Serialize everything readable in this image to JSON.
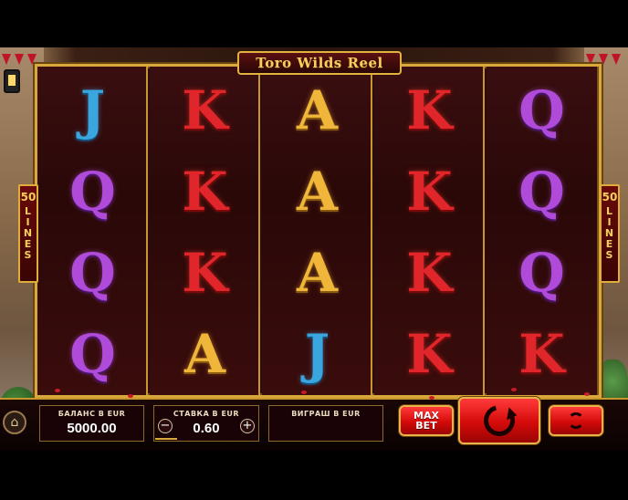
{
  "title": "Toro Wilds Reel",
  "lines": {
    "count": "50",
    "label": "LINES"
  },
  "reels": [
    [
      "J",
      "Q",
      "Q",
      "Q"
    ],
    [
      "K",
      "K",
      "K",
      "A"
    ],
    [
      "A",
      "A",
      "A",
      "J"
    ],
    [
      "K",
      "K",
      "K",
      "K"
    ],
    [
      "Q",
      "Q",
      "Q",
      "K"
    ]
  ],
  "panel": {
    "balance_caption": "БАЛАНС В EUR",
    "balance_value": "5000.00",
    "bet_caption": "СТАВКА В EUR",
    "bet_value": "0.60",
    "bet_minus": "−",
    "bet_plus": "+",
    "win_caption": "ВИГРАШ В EUR",
    "win_value": "",
    "maxbet_line1": "MAX",
    "maxbet_line2": "BET",
    "home_icon": "home-icon"
  },
  "colors": {
    "K": "#e0262a",
    "A": "#f0b63a",
    "Q": "#b04ad8",
    "J": "#3aa6e0",
    "frame": "#d8a93a",
    "button": "#d40a0a"
  }
}
